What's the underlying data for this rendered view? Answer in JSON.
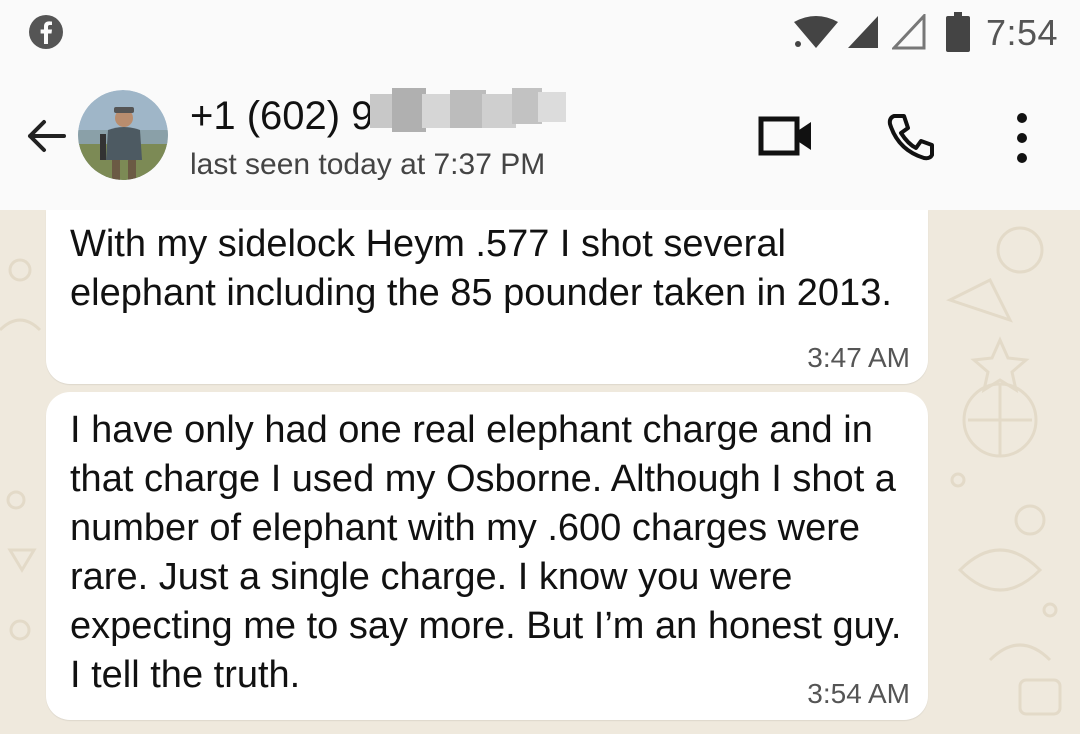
{
  "status_bar": {
    "time": "7:54",
    "icons": [
      "facebook-icon",
      "wifi-icon",
      "cell-signal-icon",
      "cell-signal-icon",
      "battery-icon"
    ]
  },
  "header": {
    "contact_name": "+1 (602) 9",
    "last_seen": "last seen today at 7:37 PM",
    "icons": [
      "back-arrow-icon",
      "video-call-icon",
      "phone-call-icon",
      "more-options-icon"
    ]
  },
  "messages": [
    {
      "text": "With my sidelock Heym .577 I shot several elephant including the 85 pounder taken in 2013.",
      "time": "3:47 AM"
    },
    {
      "text": "I have only had one real elephant charge and in that charge I used my Osborne. Although I shot a number of elephant with my .600 charges were rare. Just a single charge. I know you were expecting me to say more. But I’m an honest guy. I tell the truth.",
      "time": "3:54 AM"
    }
  ],
  "colors": {
    "chat_background": "#efe9dd",
    "bubble": "#ffffff",
    "header": "#fafafa"
  }
}
